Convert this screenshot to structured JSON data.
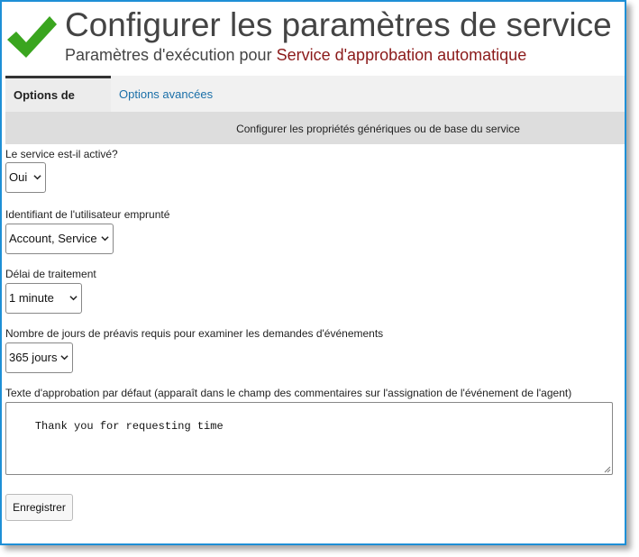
{
  "header": {
    "title": "Configurer les paramètres de service",
    "subtitle_prefix": "Paramètres d'exécution pour",
    "service_name": "Service d'approbation automatique"
  },
  "tabs": [
    {
      "label": "Options de base",
      "active": true
    },
    {
      "label": "Options avancées",
      "active": false
    }
  ],
  "section_description": "Configurer les propriétés génériques ou de base du service",
  "fields": {
    "enabled": {
      "label": "Le service est-il activé?",
      "value": "Oui"
    },
    "impersonated_user": {
      "label": "Identifiant de l'utilisateur emprunté",
      "value": "Account, Service"
    },
    "processing_delay": {
      "label": "Délai de traitement",
      "value": "1 minute"
    },
    "notice_days": {
      "label": "Nombre de jours de préavis requis pour examiner les demandes d'événements",
      "value": "365 jours"
    },
    "approval_text": {
      "label": "Texte d'approbation par défaut (apparaît dans le champ des commentaires sur l'assignation de l'événement de l'agent)",
      "value": "Thank you for requesting time"
    }
  },
  "buttons": {
    "save_label": "Enregistrer"
  },
  "colors": {
    "accent_border": "#1e8fd6",
    "check_green": "#3aa51f",
    "service_name": "#8b1a1a",
    "link": "#1a6fa8"
  }
}
